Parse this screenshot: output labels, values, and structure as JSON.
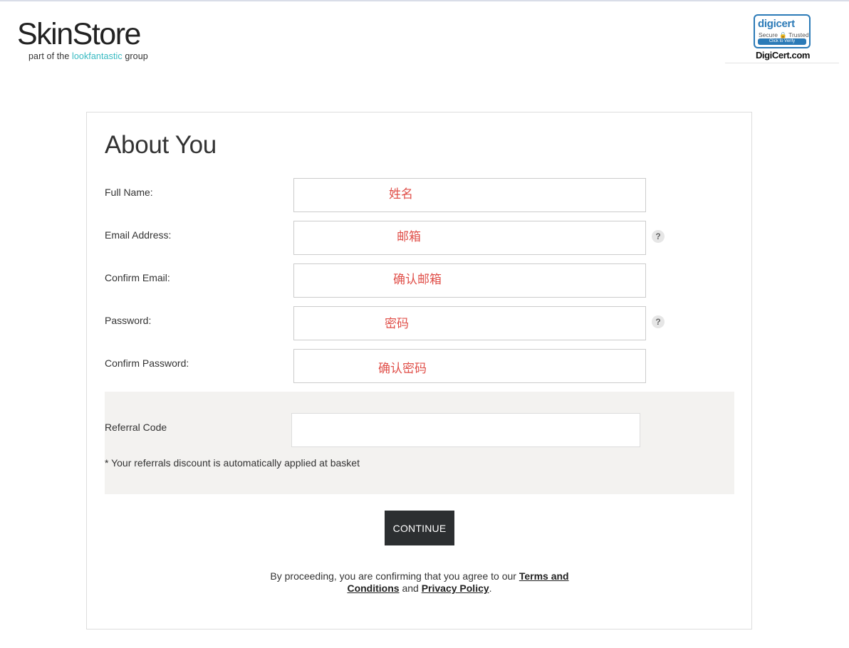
{
  "header": {
    "logo_main": "SkinStore",
    "logo_sub_prefix": "part of the ",
    "logo_sub_brand": "lookfantastic",
    "logo_sub_suffix": " group",
    "seal": {
      "brand": "digicert",
      "secure_text": "Secure 🔒 Trusted",
      "verify_text": "Click to Verify",
      "domain": "DigiCert.com"
    }
  },
  "form": {
    "title": "About You",
    "fields": [
      {
        "label": "Full Name:",
        "value": "姓名"
      },
      {
        "label": "Email Address:",
        "value": "邮箱"
      },
      {
        "label": "Confirm Email:",
        "value": "确认邮箱"
      },
      {
        "label": "Password:",
        "value": "密码"
      },
      {
        "label": "Confirm Password:",
        "value": "确认密码"
      }
    ],
    "help_icon": "?",
    "referral": {
      "label": "Referral Code",
      "value": "",
      "note": "* Your referrals discount is automatically applied at basket"
    },
    "continue_label": "CONTINUE",
    "legal": {
      "prefix": "By proceeding, you are confirming that you agree to our ",
      "terms_label": "Terms and Conditions",
      "middle": " and ",
      "privacy_label": "Privacy Policy",
      "suffix": "."
    }
  },
  "icons": {
    "help": "question-circle-icon",
    "lock": "lock-icon"
  }
}
